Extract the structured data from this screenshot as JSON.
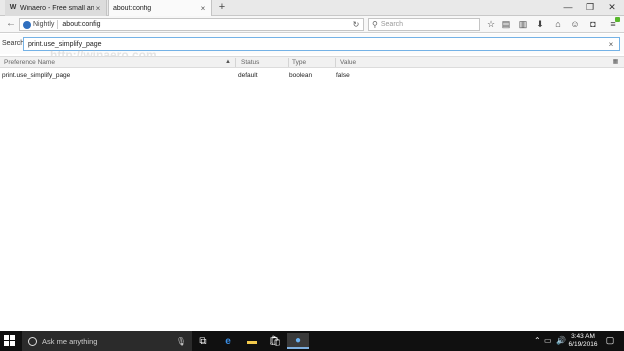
{
  "tabs": [
    {
      "favicon": "W",
      "title": "Winaero - Free small and ...",
      "close": "×"
    },
    {
      "title": "about:config",
      "close": "×"
    }
  ],
  "new_tab_label": "+",
  "window_controls": {
    "minimize": "—",
    "restore": "❐",
    "close": "✕"
  },
  "navbar": {
    "back": "←",
    "identity": "Nightly",
    "url": "about:config",
    "reload": "↻",
    "search_placeholder": "Search",
    "icons": [
      "star-icon",
      "reading-list-icon",
      "library-icon",
      "download-icon",
      "home-icon",
      "sync-icon",
      "pocket-icon",
      "menu-icon"
    ]
  },
  "config_search": {
    "label": "Search:",
    "value": "print.use_simplify_page",
    "clear": "×"
  },
  "table": {
    "headers": [
      "Preference Name",
      "Status",
      "Type",
      "Value"
    ],
    "sort_indicator": "▲",
    "rows": [
      {
        "name": "print.use_simplify_page",
        "status": "default",
        "type": "boolean",
        "value": "false"
      }
    ]
  },
  "watermark": "http://winaero.com",
  "taskbar": {
    "search_placeholder": "Ask me anything",
    "time": "3:43 AM",
    "date": "6/19/2016"
  },
  "colors": {
    "accent": "#74b2e6",
    "taskbar": "#101010"
  }
}
